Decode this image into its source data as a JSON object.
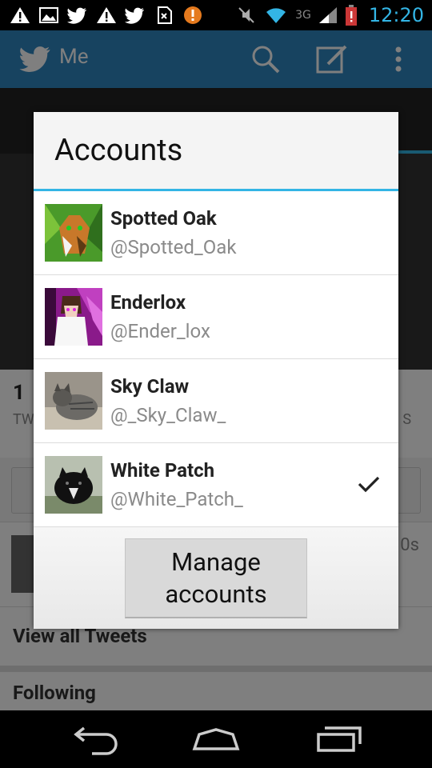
{
  "status_bar": {
    "time": "12:20",
    "network": "3G",
    "icons": [
      "alert-icon",
      "image-icon",
      "twitter-icon",
      "alert-icon",
      "twitter-icon",
      "sim-icon",
      "warning-icon",
      "mute-icon",
      "wifi-icon",
      "signal-icon",
      "battery-icon"
    ]
  },
  "app": {
    "title": "Me",
    "stat_number": "1",
    "stat_label": "TW",
    "stat_label_right": "S",
    "tweet_time": "0s",
    "view_all": "View all Tweets",
    "following": "Following"
  },
  "dialog": {
    "title": "Accounts",
    "accounts": [
      {
        "name": "Spotted Oak",
        "handle": "@Spotted_Oak",
        "selected": false
      },
      {
        "name": "Enderlox",
        "handle": "@Ender_lox",
        "selected": false
      },
      {
        "name": "Sky Claw",
        "handle": "@_Sky_Claw_",
        "selected": false
      },
      {
        "name": "White Patch",
        "handle": "@White_Patch_",
        "selected": true
      }
    ],
    "manage_button": "Manage accounts"
  },
  "colors": {
    "accent": "#33b5e5",
    "action_bar": "#2e86c1"
  }
}
